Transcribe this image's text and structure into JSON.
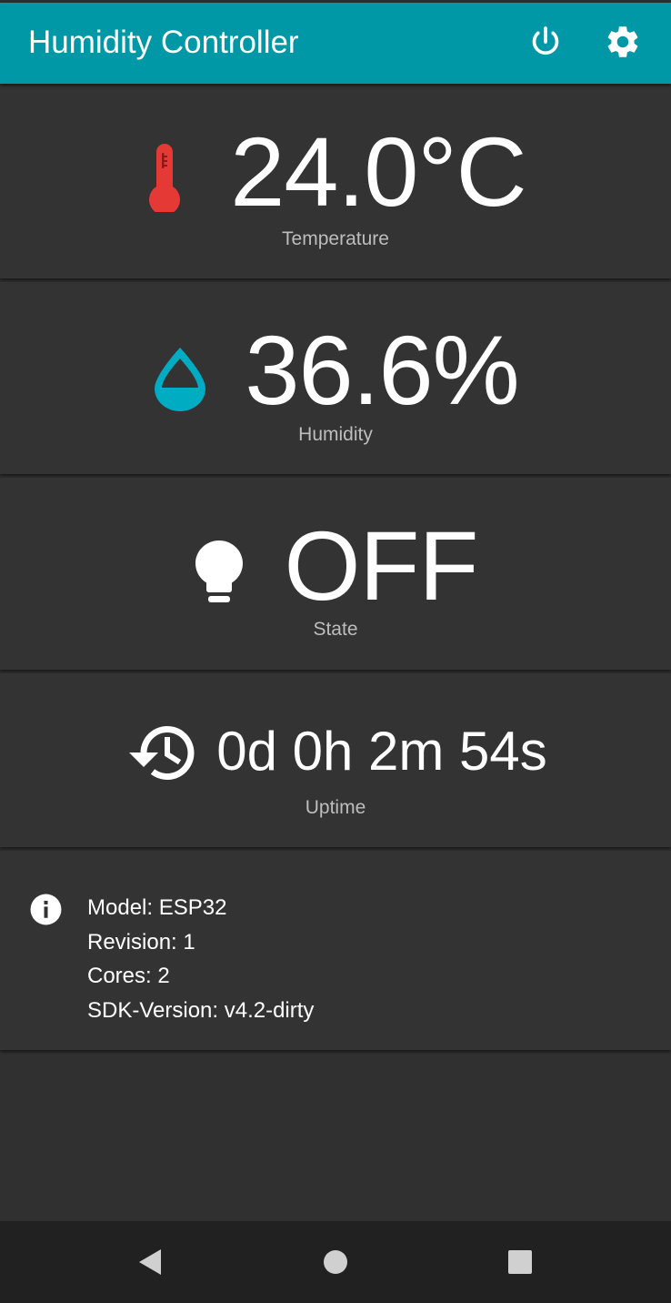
{
  "app_bar": {
    "title": "Humidity Controller",
    "actions": [
      {
        "icon": "power-icon"
      },
      {
        "icon": "gear-icon"
      }
    ],
    "background": "#0097a7"
  },
  "cards": {
    "temperature": {
      "value": "24.0°C",
      "label": "Temperature",
      "icon": "thermometer-icon",
      "icon_color": "#e53935"
    },
    "humidity": {
      "value": "36.6%",
      "label": "Humidity",
      "icon": "water-drop-icon",
      "icon_color": "#00acc1"
    },
    "state": {
      "value": "OFF",
      "label": "State",
      "icon": "lightbulb-icon",
      "icon_color": "#ffffff"
    },
    "uptime": {
      "value": "0d 0h 2m 54s",
      "label": "Uptime",
      "icon": "history-icon",
      "icon_color": "#ffffff"
    }
  },
  "info": {
    "icon": "info-icon",
    "lines": [
      "Model: ESP32",
      "Revision: 1",
      "Cores: 2",
      "SDK-Version: v4.2-dirty"
    ]
  },
  "nav_bar": {
    "buttons": [
      {
        "icon": "back-triangle-icon"
      },
      {
        "icon": "home-circle-icon"
      },
      {
        "icon": "recents-square-icon"
      }
    ]
  },
  "colors": {
    "background": "#303030",
    "card": "#333333",
    "label": "#bdbdbd",
    "nav_bar": "#212121"
  }
}
